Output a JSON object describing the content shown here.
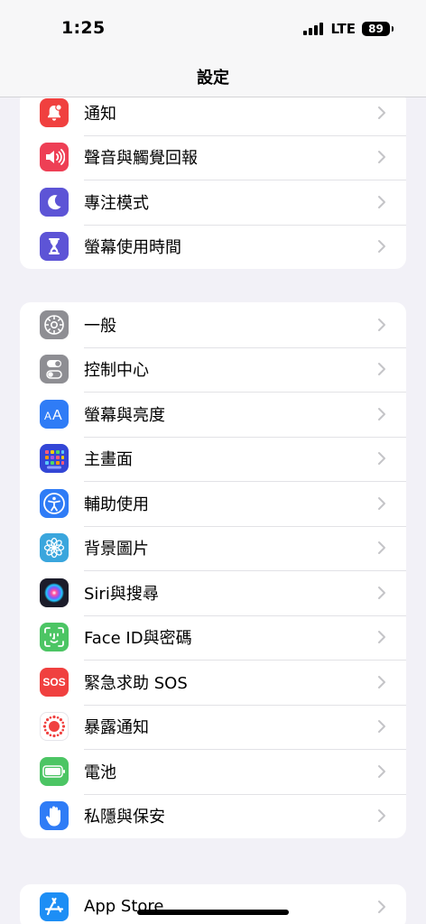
{
  "status_bar": {
    "time": "1:25",
    "network": "LTE",
    "battery": "89"
  },
  "nav": {
    "title": "設定"
  },
  "groups": [
    [
      {
        "label": "通知",
        "icon": "bell-badge-icon",
        "color": "#f0403f"
      },
      {
        "label": "聲音與觸覺回報",
        "icon": "speaker-icon",
        "color": "#ee3f55"
      },
      {
        "label": "專注模式",
        "icon": "moon-icon",
        "color": "#5d54d6"
      },
      {
        "label": "螢幕使用時間",
        "icon": "hourglass-icon",
        "color": "#5d54d6"
      }
    ],
    [
      {
        "label": "一般",
        "icon": "gear-icon",
        "color": "#8e8e93"
      },
      {
        "label": "控制中心",
        "icon": "toggles-icon",
        "color": "#8e8e93"
      },
      {
        "label": "螢幕與亮度",
        "icon": "text-size-icon",
        "color": "#2f7cf6"
      },
      {
        "label": "主畫面",
        "icon": "home-grid-icon",
        "color": "#3346d6"
      },
      {
        "label": "輔助使用",
        "icon": "accessibility-icon",
        "color": "#2f7cf6"
      },
      {
        "label": "背景圖片",
        "icon": "flower-icon",
        "color": "#3aa6dd"
      },
      {
        "label": "Siri與搜尋",
        "icon": "siri-icon",
        "color": "#1c1c2a"
      },
      {
        "label": "Face ID與密碼",
        "icon": "face-id-icon",
        "color": "#4cc564"
      },
      {
        "label": "緊急求助 SOS",
        "icon": "sos-icon",
        "color": "#f0403f",
        "icon_text": "SOS"
      },
      {
        "label": "暴露通知",
        "icon": "exposure-icon",
        "color": "#ffffff"
      },
      {
        "label": "電池",
        "icon": "battery-icon",
        "color": "#4cc564"
      },
      {
        "label": "私隱與保安",
        "icon": "hand-icon",
        "color": "#2f7cf6"
      }
    ],
    [
      {
        "label": "App Store",
        "icon": "app-store-icon",
        "color": "#1d8ef5"
      }
    ]
  ]
}
